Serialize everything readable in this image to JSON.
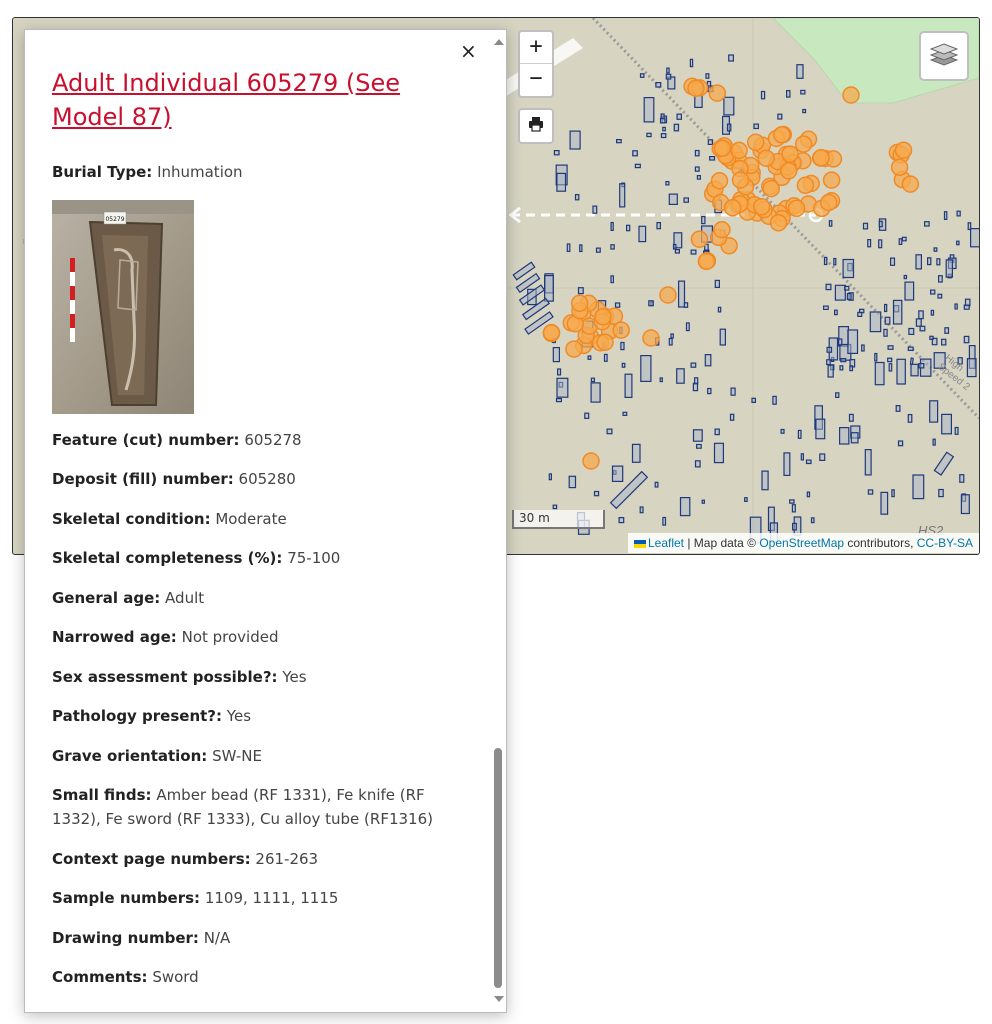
{
  "map": {
    "zoom_in_label": "+",
    "zoom_out_label": "−",
    "scale_label": "30 m",
    "watermark": "HS2",
    "road_label": "High Speed 2",
    "left_label": "ug",
    "attribution": {
      "leaflet": "Leaflet",
      "sep": " | Map data © ",
      "osm": "OpenStreetMap",
      "contrib": " contributors, ",
      "license": "CC-BY-SA"
    },
    "colors": {
      "background": "#d7d4c2",
      "park": "#c8e8bf",
      "feature_outline": "#1f3a7a",
      "marker_fill": "#f7a94d",
      "marker_stroke": "#f08a24"
    },
    "icons": [
      "print-icon",
      "layers-icon"
    ]
  },
  "popup": {
    "title": "Adult Individual 605279 (See Model 87)",
    "close_label": "×",
    "photo_label": "05279",
    "fields": [
      {
        "label": "Burial Type:",
        "value": "Inhumation"
      },
      {
        "label": "Feature (cut) number:",
        "value": "605278"
      },
      {
        "label": "Deposit (fill) number:",
        "value": "605280"
      },
      {
        "label": "Skeletal condition:",
        "value": "Moderate"
      },
      {
        "label": "Skeletal completeness (%):",
        "value": "75-100"
      },
      {
        "label": "General age:",
        "value": "Adult"
      },
      {
        "label": "Narrowed age:",
        "value": "Not provided"
      },
      {
        "label": "Sex assessment possible?:",
        "value": "Yes"
      },
      {
        "label": "Pathology present?:",
        "value": "Yes"
      },
      {
        "label": "Grave orientation:",
        "value": "SW-NE"
      },
      {
        "label": "Small finds:",
        "value": "Amber bead (RF 1331), Fe knife (RF 1332), Fe sword (RF 1333), Cu alloy tube (RF1316)"
      },
      {
        "label": "Context page numbers:",
        "value": "261-263"
      },
      {
        "label": "Sample numbers:",
        "value": "1109, 1111, 1115"
      },
      {
        "label": "Drawing number:",
        "value": "N/A"
      },
      {
        "label": "Comments:",
        "value": "Sword"
      }
    ]
  }
}
